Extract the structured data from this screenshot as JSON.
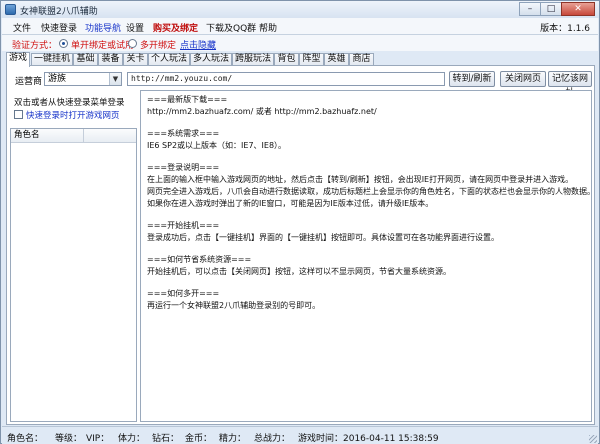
{
  "window": {
    "title": "女神联盟2八爪辅助",
    "minimize_glyph": "–",
    "maximize_glyph": "□",
    "close_glyph": "✕"
  },
  "menu": {
    "items": [
      "文件",
      "快速登录",
      "功能导航",
      "设置",
      "购买及绑定",
      "下载及QQ群",
      "帮助"
    ],
    "version": "版本：1.1.6"
  },
  "verify": {
    "label": "验证方式：",
    "option1": "单开绑定或试用",
    "option2": "多开绑定",
    "hide_link": "点击隐藏"
  },
  "tabs": [
    "游戏",
    "一键挂机",
    "基础",
    "装备",
    "关卡",
    "个人玩法",
    "多人玩法",
    "跨服玩法",
    "背包",
    "阵型",
    "英雄",
    "商店"
  ],
  "toolbar": {
    "operator_label": "运营商",
    "operator_value": "游族",
    "url": "http://mm2.youzu.com/",
    "btn_go": "转到/刷新",
    "btn_close": "关闭网页",
    "btn_remember": "记忆该网址"
  },
  "left": {
    "hint": "双击或者从快速登录菜单登录",
    "checkbox_label": "快速登录时打开游戏网页",
    "list_header": "角色名"
  },
  "content": {
    "lines": [
      "===最新版下载===",
      "http://mm2.bazhuafz.com/ 或者 http://mm2.bazhuafz.net/",
      "===系统需求===",
      "IE6 SP2或以上版本（如：IE7、IE8）。",
      "===登录说明===",
      "在上面的输入框中输入游戏网页的地址，然后点击【转到/刷新】按钮，会出现IE打开网页，请在网页中登录并进入游戏。",
      "网页完全进入游戏后，八爪会自动进行数据读取，成功后标题栏上会显示你的角色姓名，下面的状态栏也会显示你的人物数据。",
      "如果你在进入游戏时弹出了新的IE窗口，可能是因为IE版本过低，请升级IE版本。",
      "===开始挂机===",
      "登录成功后，点击【一键挂机】界面的【一键挂机】按钮即可。具体设置可在各功能界面进行设置。",
      "===如何节省系统资源===",
      "开始挂机后，可以点击【关闭网页】按钮，这样可以不显示网页，节省大量系统资源。",
      "===如何多开===",
      "再运行一个女神联盟2八爪辅助登录别的号即可。"
    ]
  },
  "status": {
    "role": "角色名：",
    "level": "等级：",
    "vip": "VIP：",
    "stamina": "体力：",
    "diamond": "钻石：",
    "gold": "金币：",
    "energy": "精力：",
    "power": "总战力：",
    "game_time": "游戏时间：2016-04-11 15:38:59"
  }
}
